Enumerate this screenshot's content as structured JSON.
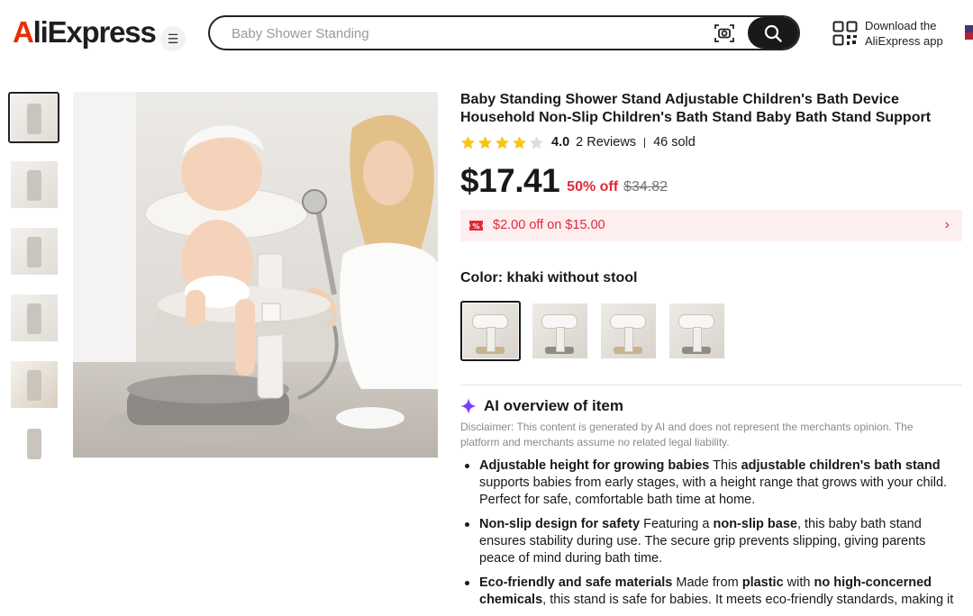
{
  "header": {
    "logo": "AliExpress",
    "search_placeholder": "Baby Shower Standing",
    "app_download_line1": "Download the",
    "app_download_line2": "AliExpress app"
  },
  "product": {
    "title": "Baby Standing Shower Stand Adjustable Children's Bath Device Household Non-Slip Children's Bath Stand Baby Bath Stand Support",
    "rating": "4.0",
    "rating_value": 4.0,
    "reviews": "2 Reviews",
    "sold": "46 sold",
    "price": "$17.41",
    "discount": "50% off",
    "original_price": "$34.82",
    "coupon": "$2.00 off on $15.00",
    "color_label": "Color: khaki without stool"
  },
  "ai_overview": {
    "title": "AI overview of item",
    "disclaimer": "Disclaimer: This content is generated by AI and does not represent the merchants opinion. The platform and merchants assume no related legal liability.",
    "bullets": [
      {
        "parts": [
          {
            "t": "Adjustable height for growing babies",
            "b": true
          },
          {
            "t": " This ",
            "b": false
          },
          {
            "t": "adjustable children's bath stand",
            "b": true
          },
          {
            "t": " supports babies from early stages, with a height range that grows with your child. Perfect for safe, comfortable bath time at home.",
            "b": false
          }
        ]
      },
      {
        "parts": [
          {
            "t": "Non-slip design for safety",
            "b": true
          },
          {
            "t": " Featuring a ",
            "b": false
          },
          {
            "t": "non-slip base",
            "b": true
          },
          {
            "t": ", this baby bath stand ensures stability during use. The secure grip prevents slipping, giving parents peace of mind during bath time.",
            "b": false
          }
        ]
      },
      {
        "parts": [
          {
            "t": "Eco-friendly and safe materials",
            "b": true
          },
          {
            "t": " Made from ",
            "b": false
          },
          {
            "t": "plastic",
            "b": true
          },
          {
            "t": " with ",
            "b": false
          },
          {
            "t": "no high-concerned chemicals",
            "b": true
          },
          {
            "t": ", this stand is safe for babies. It meets eco-friendly standards, making it",
            "b": false
          }
        ]
      }
    ]
  },
  "colors": {
    "accent_red": "#e02a37",
    "coupon_bg": "#fdeff0",
    "star": "#f8c515",
    "brand_red": "#e62e04",
    "ai_purple": "#7a3cff"
  },
  "icons": {
    "menu": "hamburger-icon",
    "camera": "camera-search-icon",
    "search": "search-icon",
    "qr": "qr-code-icon",
    "coupon": "coupon-icon",
    "chevron": "chevron-right-icon",
    "sparkle": "ai-sparkle-icon"
  }
}
